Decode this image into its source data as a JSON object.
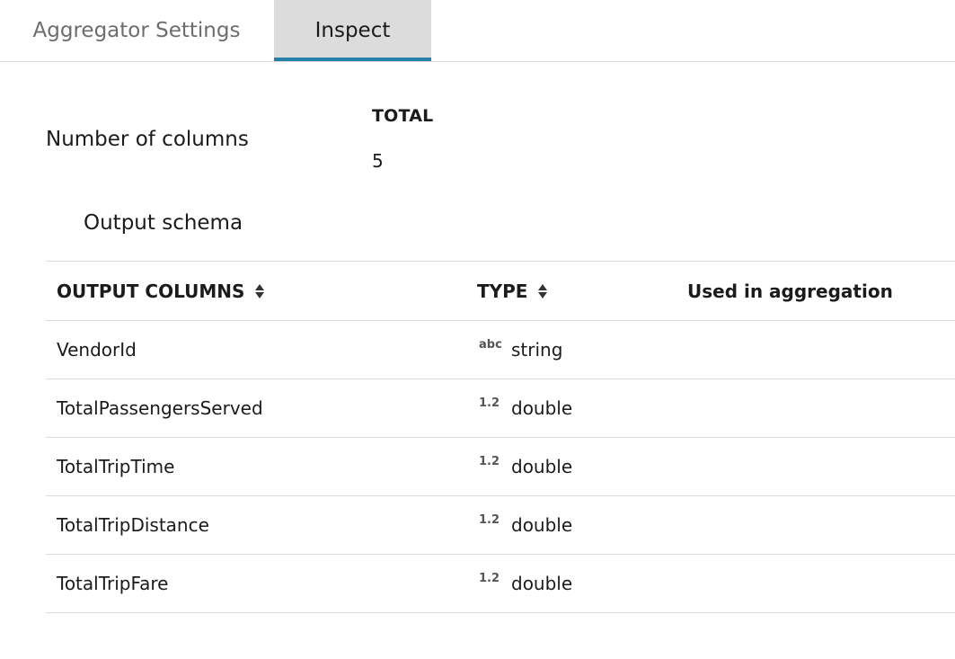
{
  "tabs": [
    {
      "label": "Aggregator Settings",
      "active": false
    },
    {
      "label": "Inspect",
      "active": true
    }
  ],
  "summary": {
    "label": "Number of columns",
    "total_header": "TOTAL",
    "total_value": "5"
  },
  "schema": {
    "title": "Output schema",
    "headers": {
      "columns": "OUTPUT COLUMNS",
      "type": "TYPE",
      "used": "Used in aggregation"
    },
    "rows": [
      {
        "name": "VendorId",
        "type_icon": "abc",
        "type": "string"
      },
      {
        "name": "TotalPassengersServed",
        "type_icon": "1.2",
        "type": "double"
      },
      {
        "name": "TotalTripTime",
        "type_icon": "1.2",
        "type": "double"
      },
      {
        "name": "TotalTripDistance",
        "type_icon": "1.2",
        "type": "double"
      },
      {
        "name": "TotalTripFare",
        "type_icon": "1.2",
        "type": "double"
      }
    ]
  },
  "colors": {
    "active_tab_bg": "#dcdcdc",
    "active_tab_accent": "#2580a8"
  }
}
